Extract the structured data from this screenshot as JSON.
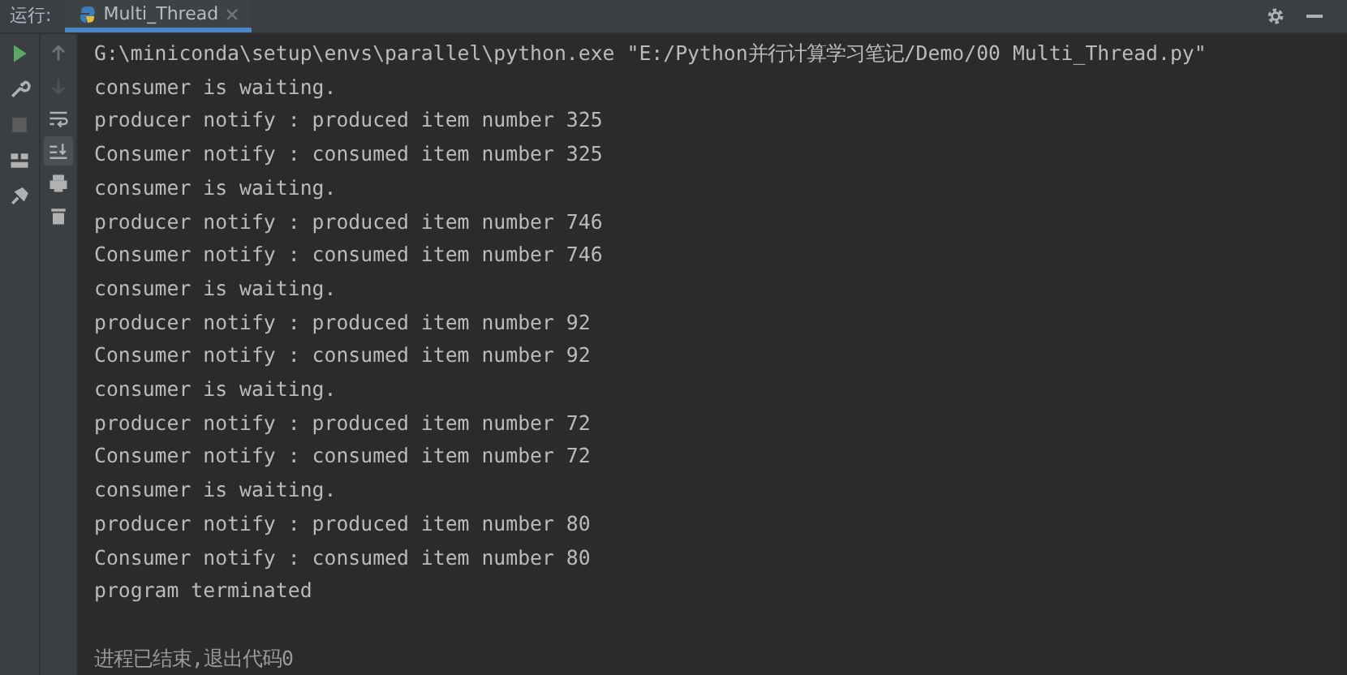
{
  "header": {
    "label": "运行:",
    "tabs": [
      {
        "title": "Multi_Thread",
        "selected": true
      }
    ]
  },
  "left_toolbar": [
    {
      "kind": "run",
      "disabled": false
    },
    {
      "kind": "wrench",
      "disabled": false
    },
    {
      "kind": "stop",
      "disabled": true
    },
    {
      "kind": "layout",
      "disabled": false
    },
    {
      "kind": "pin",
      "disabled": false
    }
  ],
  "console_toolbar": [
    {
      "kind": "up",
      "disabled": false,
      "selected": false
    },
    {
      "kind": "down",
      "disabled": true,
      "selected": false
    },
    {
      "kind": "wrap",
      "disabled": false,
      "selected": false
    },
    {
      "kind": "scroll",
      "disabled": false,
      "selected": true
    },
    {
      "kind": "print",
      "disabled": false,
      "selected": false
    },
    {
      "kind": "trash",
      "disabled": false,
      "selected": false
    }
  ],
  "console_lines": [
    {
      "kind": "output",
      "text": "G:\\miniconda\\setup\\envs\\parallel\\python.exe \"E:/Python并行计算学习笔记/Demo/00 Multi_Thread.py\""
    },
    {
      "kind": "output",
      "text": "consumer is waiting."
    },
    {
      "kind": "output",
      "text": "producer notify : produced item number 325"
    },
    {
      "kind": "output",
      "text": "Consumer notify : consumed item number 325"
    },
    {
      "kind": "output",
      "text": "consumer is waiting."
    },
    {
      "kind": "output",
      "text": "producer notify : produced item number 746"
    },
    {
      "kind": "output",
      "text": "Consumer notify : consumed item number 746"
    },
    {
      "kind": "output",
      "text": "consumer is waiting."
    },
    {
      "kind": "output",
      "text": "producer notify : produced item number 92"
    },
    {
      "kind": "output",
      "text": "Consumer notify : consumed item number 92"
    },
    {
      "kind": "output",
      "text": "consumer is waiting."
    },
    {
      "kind": "output",
      "text": "producer notify : produced item number 72"
    },
    {
      "kind": "output",
      "text": "Consumer notify : consumed item number 72"
    },
    {
      "kind": "output",
      "text": "consumer is waiting."
    },
    {
      "kind": "output",
      "text": "producer notify : produced item number 80"
    },
    {
      "kind": "output",
      "text": "Consumer notify : consumed item number 80"
    },
    {
      "kind": "output",
      "text": "program terminated"
    },
    {
      "kind": "exit",
      "text": "进程已结束,退出代码0"
    }
  ]
}
